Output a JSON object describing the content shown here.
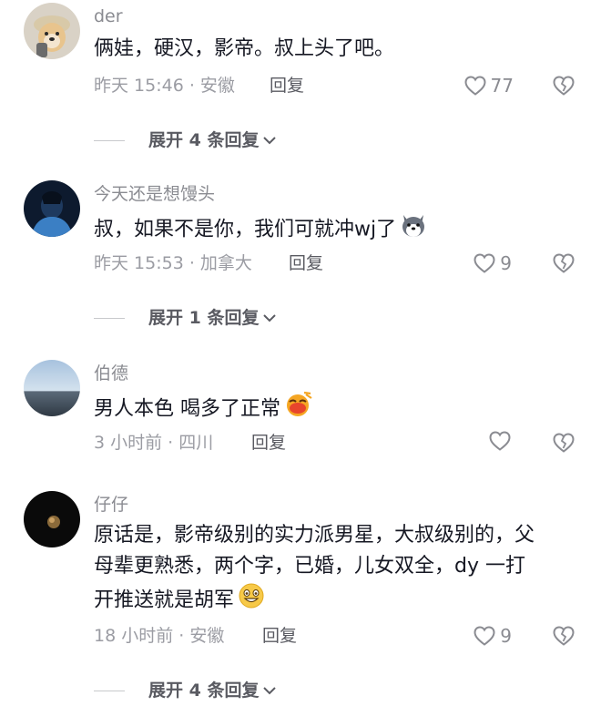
{
  "comments": [
    {
      "username": "der",
      "text": "俩娃，硬汉，影帝。叔上头了吧。",
      "meta": "昨天 15:46 · 安徽",
      "reply_label": "回复",
      "likes": "77",
      "expand_label": "展开 4 条回复"
    },
    {
      "username": "今天还是想馒头",
      "text": "叔，如果不是你，我们可就冲wj了",
      "emoji": "husky-dog-emoji",
      "meta": "昨天 15:53 · 加拿大",
      "reply_label": "回复",
      "likes": "9",
      "expand_label": "展开 1 条回复"
    },
    {
      "username": "伯德",
      "text": "男人本色 喝多了正常",
      "emoji": "tongue-out-emoji",
      "meta": "3 小时前 · 四川",
      "reply_label": "回复",
      "likes": ""
    },
    {
      "username": "仔仔",
      "text": "原话是，影帝级别的实力派男星，大叔级别的，父母辈更熟悉，两个字，已婚，儿女双全，dy 一打开推送就是胡军",
      "emoji": "grin-emoji",
      "meta": "18 小时前 · 安徽",
      "reply_label": "回复",
      "likes": "9",
      "expand_label": "展开 4 条回复"
    }
  ],
  "colors": {
    "text": "#161823",
    "secondary": "#9b9ca3",
    "icon": "#8a8b91"
  }
}
